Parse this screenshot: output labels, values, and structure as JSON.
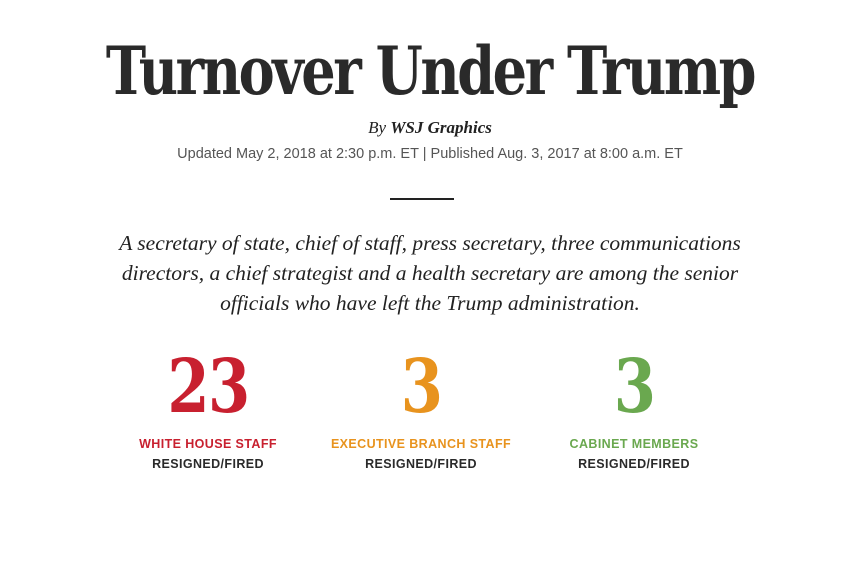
{
  "article": {
    "title": "Turnover Under Trump",
    "byline_prefix": "By",
    "byline_name": "WSJ Graphics",
    "dateline": "Updated May 2, 2018 at 2:30 p.m. ET | Published Aug. 3, 2017 at 8:00 a.m. ET",
    "dek": "A secretary of state, chief of staff, press secretary, three communications directors, a chief strategist and a health secretary are among the senior officials who have left the Trump administration."
  },
  "stats": [
    {
      "number": "23",
      "label": "WHITE HOUSE STAFF",
      "sub": "RESIGNED/FIRED",
      "color": "#c8202f"
    },
    {
      "number": "3",
      "label": "EXECUTIVE BRANCH STAFF",
      "sub": "RESIGNED/FIRED",
      "color": "#e8931e"
    },
    {
      "number": "3",
      "label": "CABINET MEMBERS",
      "sub": "RESIGNED/FIRED",
      "color": "#6aa84f"
    }
  ]
}
